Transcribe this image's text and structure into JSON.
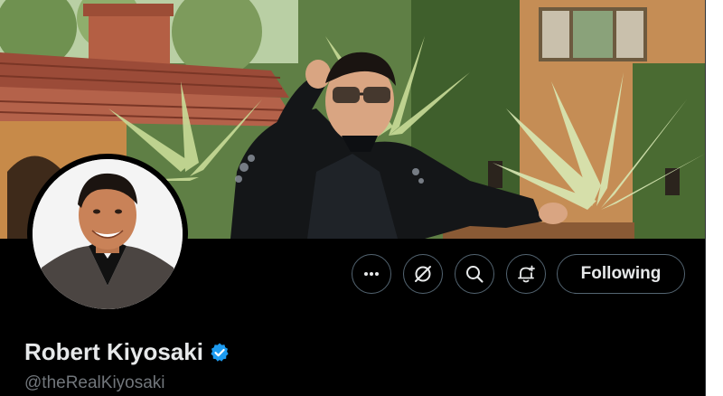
{
  "profile": {
    "display_name": "Robert Kiyosaki",
    "handle": "@theRealKiyosaki",
    "verified": true
  },
  "actions": {
    "follow_label": "Following",
    "icons": [
      "more-icon",
      "grok-icon",
      "search-icon",
      "notification-bell-icon"
    ]
  },
  "colors": {
    "background": "#000000",
    "text_primary": "#e7e9ea",
    "text_secondary": "#71767b",
    "button_border": "#536471",
    "verified_badge": "#1d9bf0"
  }
}
